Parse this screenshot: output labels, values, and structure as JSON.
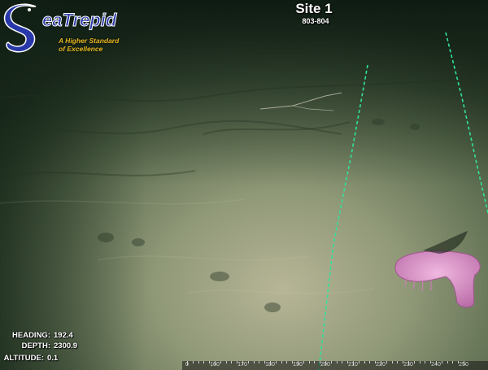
{
  "overlay": {
    "site_title": "Site 1",
    "site_subtitle": "803-804"
  },
  "logo": {
    "brand": "SeaTrepid",
    "tagline_line1": "A Higher Standard",
    "tagline_line2": "of Excellence",
    "brand_color": "#2838a8",
    "tagline_color": "#e8b820"
  },
  "telemetry": {
    "heading_label": "HEADING:",
    "heading_value": "192.4",
    "depth_label": "DEPTH:",
    "depth_value": "2300.9",
    "altitude_label": "ALTITUDE:",
    "altitude_value": "0.1"
  },
  "compass_ruler": {
    "tick_labels": [
      "0",
      "160",
      "170",
      "180",
      "190",
      "200",
      "210",
      "220",
      "230",
      "240",
      "250"
    ]
  },
  "scene": {
    "seafloor_color": "#a9b08e",
    "laser_line_color": "#2fe39a",
    "animal_color": "#d48fc0"
  }
}
